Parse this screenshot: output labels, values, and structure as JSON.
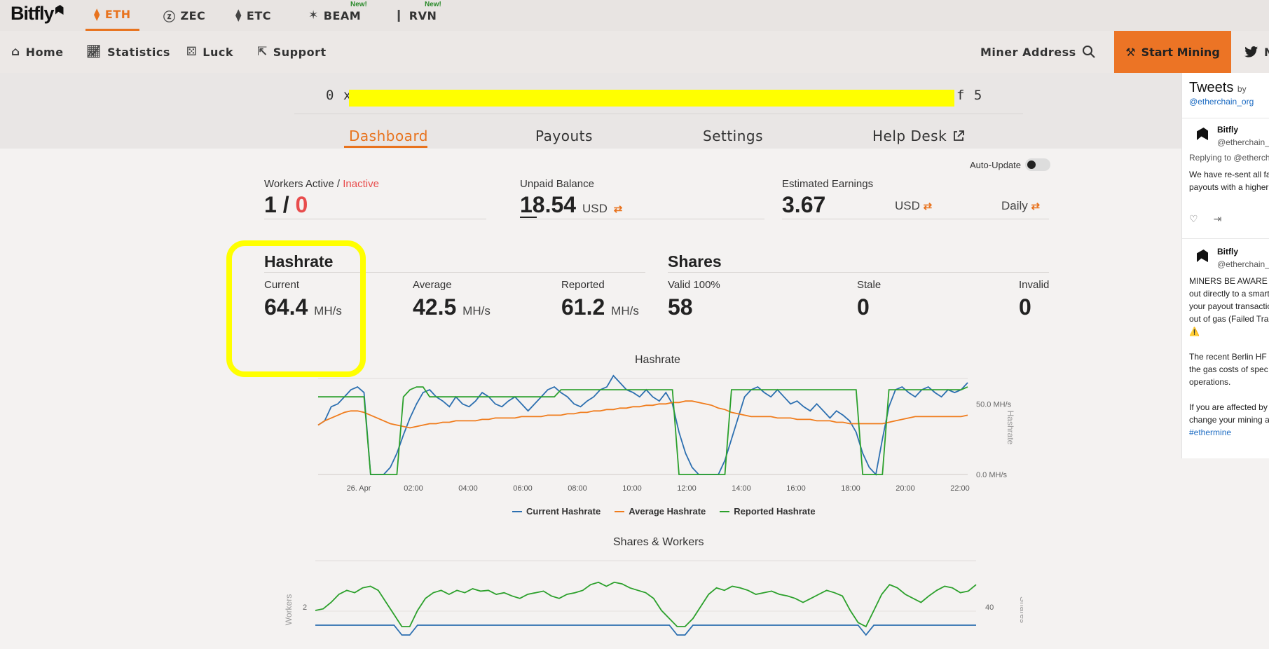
{
  "logo": "Bitfly",
  "coins": [
    {
      "label": "ETH",
      "icon": "⧫",
      "active": true
    },
    {
      "label": "ZEC",
      "icon": "ⓩ"
    },
    {
      "label": "ETC",
      "icon": "⧫"
    },
    {
      "label": "BEAM",
      "icon": "✶",
      "badge": "New!"
    },
    {
      "label": "RVN",
      "icon": "❙",
      "badge": "New!"
    }
  ],
  "nav": {
    "home": "Home",
    "statistics": "Statistics",
    "luck": "Luck",
    "support": "Support",
    "miner_address": "Miner Address",
    "start_mining": "Start Mining"
  },
  "address": {
    "prefix": "0 x",
    "suffix": "f 5"
  },
  "tabs": {
    "dashboard": "Dashboard",
    "payouts": "Payouts",
    "settings": "Settings",
    "helpdesk": "Help Desk"
  },
  "auto_update": "Auto-Update",
  "stats": {
    "workers_label": "Workers Active / ",
    "workers_inactive_label": "Inactive",
    "workers_active": "1 / ",
    "workers_inactive": "0",
    "unpaid_label": "Unpaid Balance",
    "unpaid_value": "18.54",
    "unpaid_unit": "USD",
    "earnings_label": "Estimated Earnings",
    "earnings_value": "3.67",
    "earnings_unit": "USD",
    "earnings_period": "Daily"
  },
  "hashrate": {
    "title": "Hashrate",
    "current_label": "Current",
    "current_value": "64.4",
    "current_unit": "MH/s",
    "average_label": "Average",
    "average_value": "42.5",
    "average_unit": "MH/s",
    "reported_label": "Reported",
    "reported_value": "61.2",
    "reported_unit": "MH/s"
  },
  "shares": {
    "title": "Shares",
    "valid_label": "Valid 100%",
    "valid_value": "58",
    "stale_label": "Stale",
    "stale_value": "0",
    "invalid_label": "Invalid",
    "invalid_value": "0"
  },
  "chart_data": [
    {
      "type": "line",
      "title": "Hashrate",
      "ylabel": "Hashrate",
      "x_ticks": [
        "26. Apr",
        "02:00",
        "04:00",
        "06:00",
        "08:00",
        "10:00",
        "12:00",
        "14:00",
        "16:00",
        "18:00",
        "20:00",
        "22:00"
      ],
      "y_ticks": [
        "0.0 MH/s",
        "50.0 MH/s"
      ],
      "ylim": [
        0,
        68
      ],
      "x_hours": [
        0,
        23
      ],
      "colors": {
        "current": "#2c6fb0",
        "average": "#f07c1c",
        "reported": "#2ba02b"
      },
      "series": [
        {
          "name": "Current Hashrate",
          "values": [
            35,
            38,
            48,
            50,
            55,
            60,
            62,
            58,
            0,
            0,
            0,
            5,
            15,
            28,
            40,
            50,
            58,
            60,
            55,
            52,
            48,
            55,
            50,
            48,
            52,
            58,
            55,
            50,
            48,
            52,
            55,
            50,
            45,
            50,
            55,
            60,
            62,
            58,
            55,
            50,
            48,
            52,
            55,
            60,
            62,
            70,
            65,
            60,
            58,
            55,
            60,
            55,
            52,
            58,
            50,
            30,
            15,
            5,
            0,
            0,
            0,
            0,
            10,
            25,
            40,
            55,
            60,
            62,
            58,
            55,
            60,
            55,
            50,
            52,
            48,
            45,
            50,
            45,
            40,
            45,
            42,
            38,
            30,
            15,
            5,
            0,
            25,
            48,
            60,
            62,
            58,
            55,
            60,
            62,
            58,
            55,
            60,
            58,
            60,
            65
          ]
        },
        {
          "name": "Average Hashrate",
          "values": [
            35,
            38,
            40,
            42,
            44,
            45,
            45,
            44,
            42,
            40,
            38,
            36,
            35,
            34,
            33,
            34,
            35,
            36,
            36,
            37,
            37,
            38,
            38,
            38,
            38,
            39,
            39,
            40,
            40,
            40,
            40,
            41,
            41,
            41,
            41,
            42,
            42,
            42,
            43,
            43,
            44,
            44,
            45,
            45,
            46,
            46,
            47,
            47,
            48,
            48,
            49,
            49,
            50,
            50,
            51,
            51,
            52,
            52,
            51,
            50,
            49,
            47,
            46,
            44,
            43,
            42,
            41,
            41,
            41,
            41,
            40,
            40,
            40,
            39,
            39,
            39,
            38,
            38,
            38,
            37,
            37,
            36,
            36,
            36,
            36,
            36,
            36,
            37,
            38,
            39,
            40,
            41,
            41,
            41,
            41,
            41,
            41,
            41,
            41,
            42
          ]
        },
        {
          "name": "Reported Hashrate",
          "values": [
            55,
            55,
            55,
            55,
            55,
            55,
            55,
            55,
            0,
            0,
            0,
            0,
            0,
            55,
            60,
            62,
            62,
            55,
            55,
            55,
            55,
            55,
            55,
            55,
            55,
            55,
            55,
            55,
            55,
            55,
            55,
            55,
            55,
            55,
            55,
            55,
            55,
            60,
            60,
            60,
            60,
            60,
            60,
            60,
            60,
            60,
            60,
            60,
            60,
            60,
            60,
            60,
            60,
            60,
            60,
            0,
            0,
            0,
            0,
            0,
            0,
            0,
            0,
            60,
            60,
            60,
            60,
            60,
            60,
            60,
            60,
            60,
            60,
            60,
            60,
            60,
            60,
            60,
            60,
            60,
            60,
            60,
            60,
            0,
            0,
            0,
            0,
            60,
            60,
            60,
            60,
            60,
            60,
            60,
            60,
            60,
            60,
            60,
            60,
            62
          ]
        }
      ]
    },
    {
      "type": "line",
      "title": "Shares & Workers",
      "ylabel_left": "Workers",
      "ylabel_right": "Shares",
      "y_tick_left": "2",
      "y_tick_right": "40",
      "series": [
        {
          "name": "Shares",
          "values": [
            20,
            22,
            30,
            40,
            45,
            42,
            48,
            50,
            45,
            30,
            15,
            0,
            0,
            20,
            35,
            42,
            45,
            40,
            45,
            42,
            47,
            44,
            45,
            40,
            42,
            38,
            35,
            40,
            42,
            44,
            38,
            35,
            40,
            42,
            45,
            52,
            55,
            50,
            55,
            53,
            48,
            45,
            42,
            35,
            20,
            10,
            0,
            0,
            10,
            25,
            40,
            48,
            45,
            50,
            48,
            45,
            40,
            42,
            44,
            40,
            38,
            35,
            30,
            35,
            40,
            45,
            42,
            38,
            20,
            5,
            0,
            20,
            40,
            52,
            48,
            40,
            35,
            30,
            38,
            45,
            50,
            48,
            42,
            44,
            52
          ]
        },
        {
          "name": "Workers",
          "values": [
            1,
            1,
            1,
            1,
            1,
            1,
            1,
            1,
            1,
            1,
            1,
            0,
            0,
            1,
            1,
            1,
            1,
            1,
            1,
            1,
            1,
            1,
            1,
            1,
            1,
            1,
            1,
            1,
            1,
            1,
            1,
            1,
            1,
            1,
            1,
            1,
            1,
            1,
            1,
            1,
            1,
            1,
            1,
            1,
            1,
            1,
            0,
            0,
            1,
            1,
            1,
            1,
            1,
            1,
            1,
            1,
            1,
            1,
            1,
            1,
            1,
            1,
            1,
            1,
            1,
            1,
            1,
            1,
            1,
            1,
            0,
            1,
            1,
            1,
            1,
            1,
            1,
            1,
            1,
            1,
            1,
            1,
            1,
            1,
            1
          ]
        }
      ],
      "colors": {
        "shares": "#2ba02b",
        "workers": "#2c6fb0"
      }
    }
  ],
  "tweets": {
    "title": "Tweets",
    "by": "by",
    "handle": "@etherchain_org",
    "items": [
      {
        "name": "Bitfly",
        "handle": "@etherchain_",
        "reply": "Replying to @etherch",
        "lines": [
          "We have re-sent all fa",
          "payouts with a higher"
        ]
      },
      {
        "name": "Bitfly",
        "handle": "@etherchain_",
        "lines": [
          "MINERS BE AWARE",
          "out directly to a smart",
          "your payout transactio",
          "out of gas (Failed Tra",
          "⚠️",
          "",
          "The recent Berlin HF",
          "the gas costs of spec",
          "operations.",
          "",
          "If you are affected by",
          "change your mining a"
        ],
        "hashtag": "#ethermine"
      }
    ]
  }
}
